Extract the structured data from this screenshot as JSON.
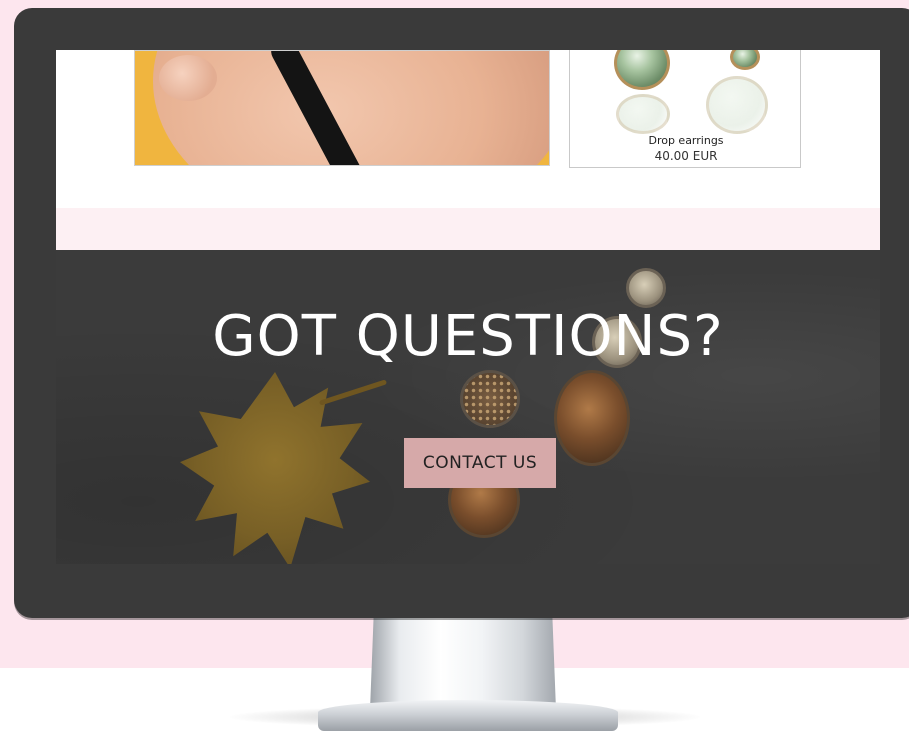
{
  "product_card": {
    "name": "Drop earrings",
    "price": "40.00 EUR"
  },
  "cta_section": {
    "heading": "GOT QUESTIONS?",
    "button_label": "CONTACT US"
  },
  "colors": {
    "page_background": "#fde6ee",
    "monitor_bezel": "#3a3a3a",
    "button_background": "#d6a9a9",
    "photo_background": "#f0b53f"
  }
}
